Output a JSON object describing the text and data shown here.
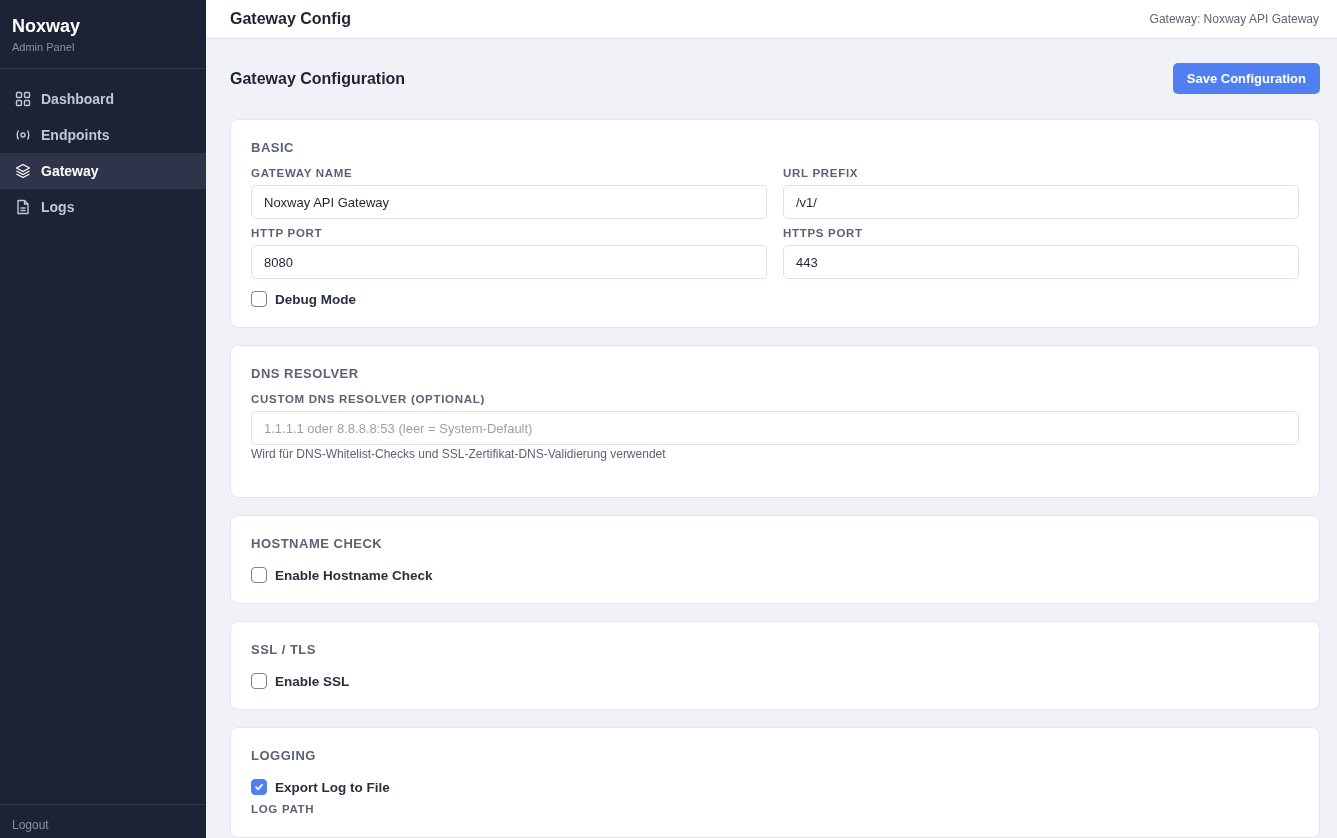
{
  "sidebar": {
    "brand": "Noxway",
    "subtitle": "Admin Panel",
    "items": [
      {
        "label": "Dashboard",
        "selected": false
      },
      {
        "label": "Endpoints",
        "selected": false
      },
      {
        "label": "Gateway",
        "selected": true
      },
      {
        "label": "Logs",
        "selected": false
      }
    ],
    "logout": "Logout"
  },
  "header": {
    "title": "Gateway Config",
    "context": "Gateway: Noxway API Gateway"
  },
  "page": {
    "title": "Gateway Configuration",
    "save_button": "Save Configuration"
  },
  "sections": [
    {
      "title": "BASIC",
      "items": [
        {
          "kind": "fields",
          "fields": [
            {
              "label": "GATEWAY NAME",
              "value": "Noxway API Gateway"
            },
            {
              "label": "URL PREFIX",
              "value": "/v1/"
            }
          ]
        },
        {
          "kind": "fields",
          "fields": [
            {
              "label": "HTTP PORT",
              "value": "8080"
            },
            {
              "label": "HTTPS PORT",
              "value": "443"
            }
          ]
        },
        {
          "kind": "checkbox",
          "label": "Debug Mode",
          "checked": false
        }
      ]
    },
    {
      "title": "DNS RESOLVER",
      "items": [
        {
          "kind": "fields",
          "fields": [
            {
              "label": "CUSTOM DNS RESOLVER (OPTIONAL)",
              "placeholder": "1.1.1.1 oder 8.8.8.8:53 (leer = System-Default)"
            }
          ],
          "hint": "Wird für DNS-Whitelist-Checks und SSL-Zertifikat-DNS-Validierung verwendet"
        }
      ]
    },
    {
      "title": "HOSTNAME CHECK",
      "items": [
        {
          "kind": "checkbox",
          "label": "Enable Hostname Check",
          "checked": false
        }
      ]
    },
    {
      "title": "SSL / TLS",
      "items": [
        {
          "kind": "checkbox",
          "label": "Enable SSL",
          "checked": false
        }
      ]
    },
    {
      "title": "LOGGING",
      "items": [
        {
          "kind": "checkbox",
          "label": "Export Log to File",
          "checked": true
        },
        {
          "kind": "label",
          "label": "LOG PATH"
        }
      ]
    }
  ]
}
